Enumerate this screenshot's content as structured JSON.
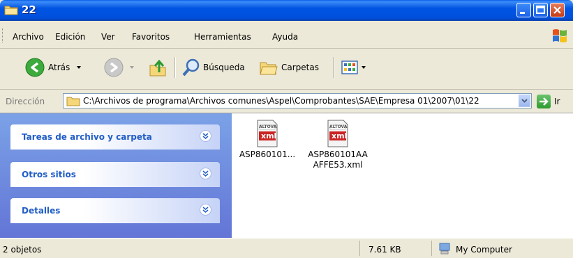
{
  "window": {
    "title": "22"
  },
  "menu": {
    "items": [
      "Archivo",
      "Edición",
      "Ver",
      "Favoritos",
      "Herramientas",
      "Ayuda"
    ]
  },
  "toolbar": {
    "back_label": "Atrás",
    "search_label": "Búsqueda",
    "folders_label": "Carpetas"
  },
  "address": {
    "label": "Dirección",
    "path": "C:\\Archivos de programa\\Archivos comunes\\Aspel\\Comprobantes\\SAE\\Empresa 01\\2007\\01\\22",
    "go_label": "Ir"
  },
  "taskpane": {
    "sections": [
      "Tareas de archivo y carpeta",
      "Otros sitios",
      "Detalles"
    ]
  },
  "files": [
    {
      "name": "ASP860101...",
      "icon_text": "ALTOVA",
      "ext": "xml"
    },
    {
      "name": "ASP860101AA AFFE53.xml",
      "name_line1": "ASP860101AA",
      "name_line2": "AFFE53.xml",
      "icon_text": "ALTOVA",
      "ext": "xml"
    }
  ],
  "status": {
    "count": "2 objetos",
    "size": "7.61 KB",
    "location": "My Computer"
  },
  "colors": {
    "titlebar": "#0054E3",
    "taskpane_link": "#215DC6",
    "xml_red": "#CC2222"
  }
}
